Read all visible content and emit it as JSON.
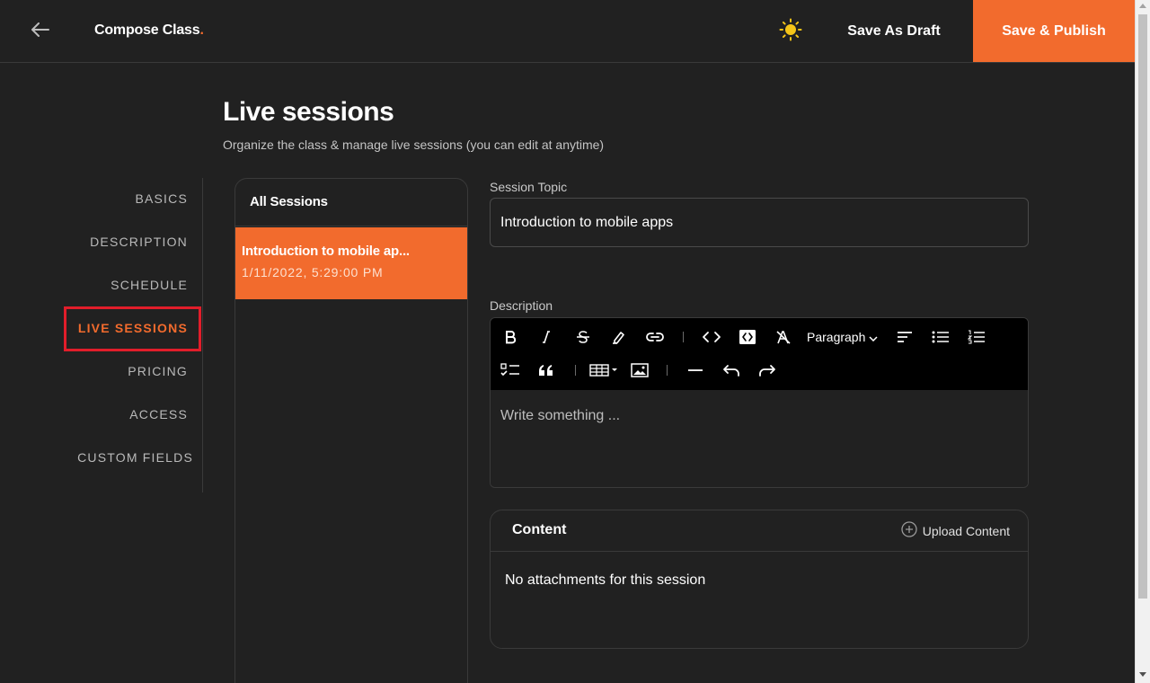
{
  "header": {
    "brand": "Compose Class",
    "brand_dot": ".",
    "save_draft_label": "Save As Draft",
    "publish_label": "Save & Publish"
  },
  "page": {
    "title": "Live sessions",
    "subtitle": "Organize the class & manage live sessions (you can edit at anytime)"
  },
  "nav": {
    "items": [
      {
        "label": "BASICS"
      },
      {
        "label": "DESCRIPTION"
      },
      {
        "label": "SCHEDULE"
      },
      {
        "label": "LIVE SESSIONS"
      },
      {
        "label": "PRICING"
      },
      {
        "label": "ACCESS"
      },
      {
        "label": "CUSTOM FIELDS"
      }
    ]
  },
  "sessions": {
    "heading": "All Sessions",
    "items": [
      {
        "title": "Introduction to mobile ap...",
        "date": "1/11/2022, 5:29:00 PM"
      }
    ]
  },
  "form": {
    "topic_label": "Session Topic",
    "topic_value": "Introduction to mobile apps",
    "description_label": "Description",
    "paragraph_label": "Paragraph",
    "editor_placeholder": "Write something ..."
  },
  "content": {
    "title": "Content",
    "upload_label": "Upload Content",
    "empty_text": "No attachments for this session"
  },
  "colors": {
    "accent": "#f26b2d",
    "background": "#212121",
    "highlight_box": "#e11d2a",
    "sun": "#f5c518"
  }
}
